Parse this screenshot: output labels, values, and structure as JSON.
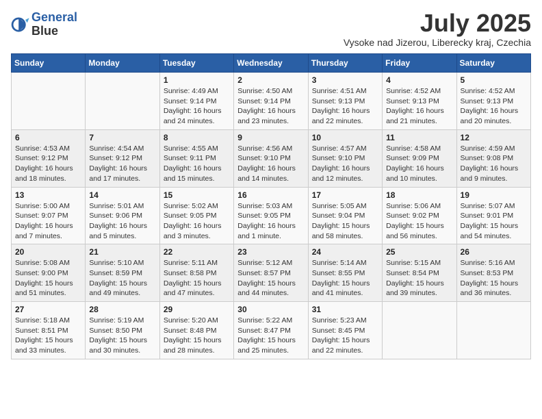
{
  "header": {
    "logo_line1": "General",
    "logo_line2": "Blue",
    "month": "July 2025",
    "location": "Vysoke nad Jizerou, Liberecky kraj, Czechia"
  },
  "weekdays": [
    "Sunday",
    "Monday",
    "Tuesday",
    "Wednesday",
    "Thursday",
    "Friday",
    "Saturday"
  ],
  "weeks": [
    [
      {
        "day": "",
        "info": ""
      },
      {
        "day": "",
        "info": ""
      },
      {
        "day": "1",
        "info": "Sunrise: 4:49 AM\nSunset: 9:14 PM\nDaylight: 16 hours\nand 24 minutes."
      },
      {
        "day": "2",
        "info": "Sunrise: 4:50 AM\nSunset: 9:14 PM\nDaylight: 16 hours\nand 23 minutes."
      },
      {
        "day": "3",
        "info": "Sunrise: 4:51 AM\nSunset: 9:13 PM\nDaylight: 16 hours\nand 22 minutes."
      },
      {
        "day": "4",
        "info": "Sunrise: 4:52 AM\nSunset: 9:13 PM\nDaylight: 16 hours\nand 21 minutes."
      },
      {
        "day": "5",
        "info": "Sunrise: 4:52 AM\nSunset: 9:13 PM\nDaylight: 16 hours\nand 20 minutes."
      }
    ],
    [
      {
        "day": "6",
        "info": "Sunrise: 4:53 AM\nSunset: 9:12 PM\nDaylight: 16 hours\nand 18 minutes."
      },
      {
        "day": "7",
        "info": "Sunrise: 4:54 AM\nSunset: 9:12 PM\nDaylight: 16 hours\nand 17 minutes."
      },
      {
        "day": "8",
        "info": "Sunrise: 4:55 AM\nSunset: 9:11 PM\nDaylight: 16 hours\nand 15 minutes."
      },
      {
        "day": "9",
        "info": "Sunrise: 4:56 AM\nSunset: 9:10 PM\nDaylight: 16 hours\nand 14 minutes."
      },
      {
        "day": "10",
        "info": "Sunrise: 4:57 AM\nSunset: 9:10 PM\nDaylight: 16 hours\nand 12 minutes."
      },
      {
        "day": "11",
        "info": "Sunrise: 4:58 AM\nSunset: 9:09 PM\nDaylight: 16 hours\nand 10 minutes."
      },
      {
        "day": "12",
        "info": "Sunrise: 4:59 AM\nSunset: 9:08 PM\nDaylight: 16 hours\nand 9 minutes."
      }
    ],
    [
      {
        "day": "13",
        "info": "Sunrise: 5:00 AM\nSunset: 9:07 PM\nDaylight: 16 hours\nand 7 minutes."
      },
      {
        "day": "14",
        "info": "Sunrise: 5:01 AM\nSunset: 9:06 PM\nDaylight: 16 hours\nand 5 minutes."
      },
      {
        "day": "15",
        "info": "Sunrise: 5:02 AM\nSunset: 9:05 PM\nDaylight: 16 hours\nand 3 minutes."
      },
      {
        "day": "16",
        "info": "Sunrise: 5:03 AM\nSunset: 9:05 PM\nDaylight: 16 hours\nand 1 minute."
      },
      {
        "day": "17",
        "info": "Sunrise: 5:05 AM\nSunset: 9:04 PM\nDaylight: 15 hours\nand 58 minutes."
      },
      {
        "day": "18",
        "info": "Sunrise: 5:06 AM\nSunset: 9:02 PM\nDaylight: 15 hours\nand 56 minutes."
      },
      {
        "day": "19",
        "info": "Sunrise: 5:07 AM\nSunset: 9:01 PM\nDaylight: 15 hours\nand 54 minutes."
      }
    ],
    [
      {
        "day": "20",
        "info": "Sunrise: 5:08 AM\nSunset: 9:00 PM\nDaylight: 15 hours\nand 51 minutes."
      },
      {
        "day": "21",
        "info": "Sunrise: 5:10 AM\nSunset: 8:59 PM\nDaylight: 15 hours\nand 49 minutes."
      },
      {
        "day": "22",
        "info": "Sunrise: 5:11 AM\nSunset: 8:58 PM\nDaylight: 15 hours\nand 47 minutes."
      },
      {
        "day": "23",
        "info": "Sunrise: 5:12 AM\nSunset: 8:57 PM\nDaylight: 15 hours\nand 44 minutes."
      },
      {
        "day": "24",
        "info": "Sunrise: 5:14 AM\nSunset: 8:55 PM\nDaylight: 15 hours\nand 41 minutes."
      },
      {
        "day": "25",
        "info": "Sunrise: 5:15 AM\nSunset: 8:54 PM\nDaylight: 15 hours\nand 39 minutes."
      },
      {
        "day": "26",
        "info": "Sunrise: 5:16 AM\nSunset: 8:53 PM\nDaylight: 15 hours\nand 36 minutes."
      }
    ],
    [
      {
        "day": "27",
        "info": "Sunrise: 5:18 AM\nSunset: 8:51 PM\nDaylight: 15 hours\nand 33 minutes."
      },
      {
        "day": "28",
        "info": "Sunrise: 5:19 AM\nSunset: 8:50 PM\nDaylight: 15 hours\nand 30 minutes."
      },
      {
        "day": "29",
        "info": "Sunrise: 5:20 AM\nSunset: 8:48 PM\nDaylight: 15 hours\nand 28 minutes."
      },
      {
        "day": "30",
        "info": "Sunrise: 5:22 AM\nSunset: 8:47 PM\nDaylight: 15 hours\nand 25 minutes."
      },
      {
        "day": "31",
        "info": "Sunrise: 5:23 AM\nSunset: 8:45 PM\nDaylight: 15 hours\nand 22 minutes."
      },
      {
        "day": "",
        "info": ""
      },
      {
        "day": "",
        "info": ""
      }
    ]
  ]
}
